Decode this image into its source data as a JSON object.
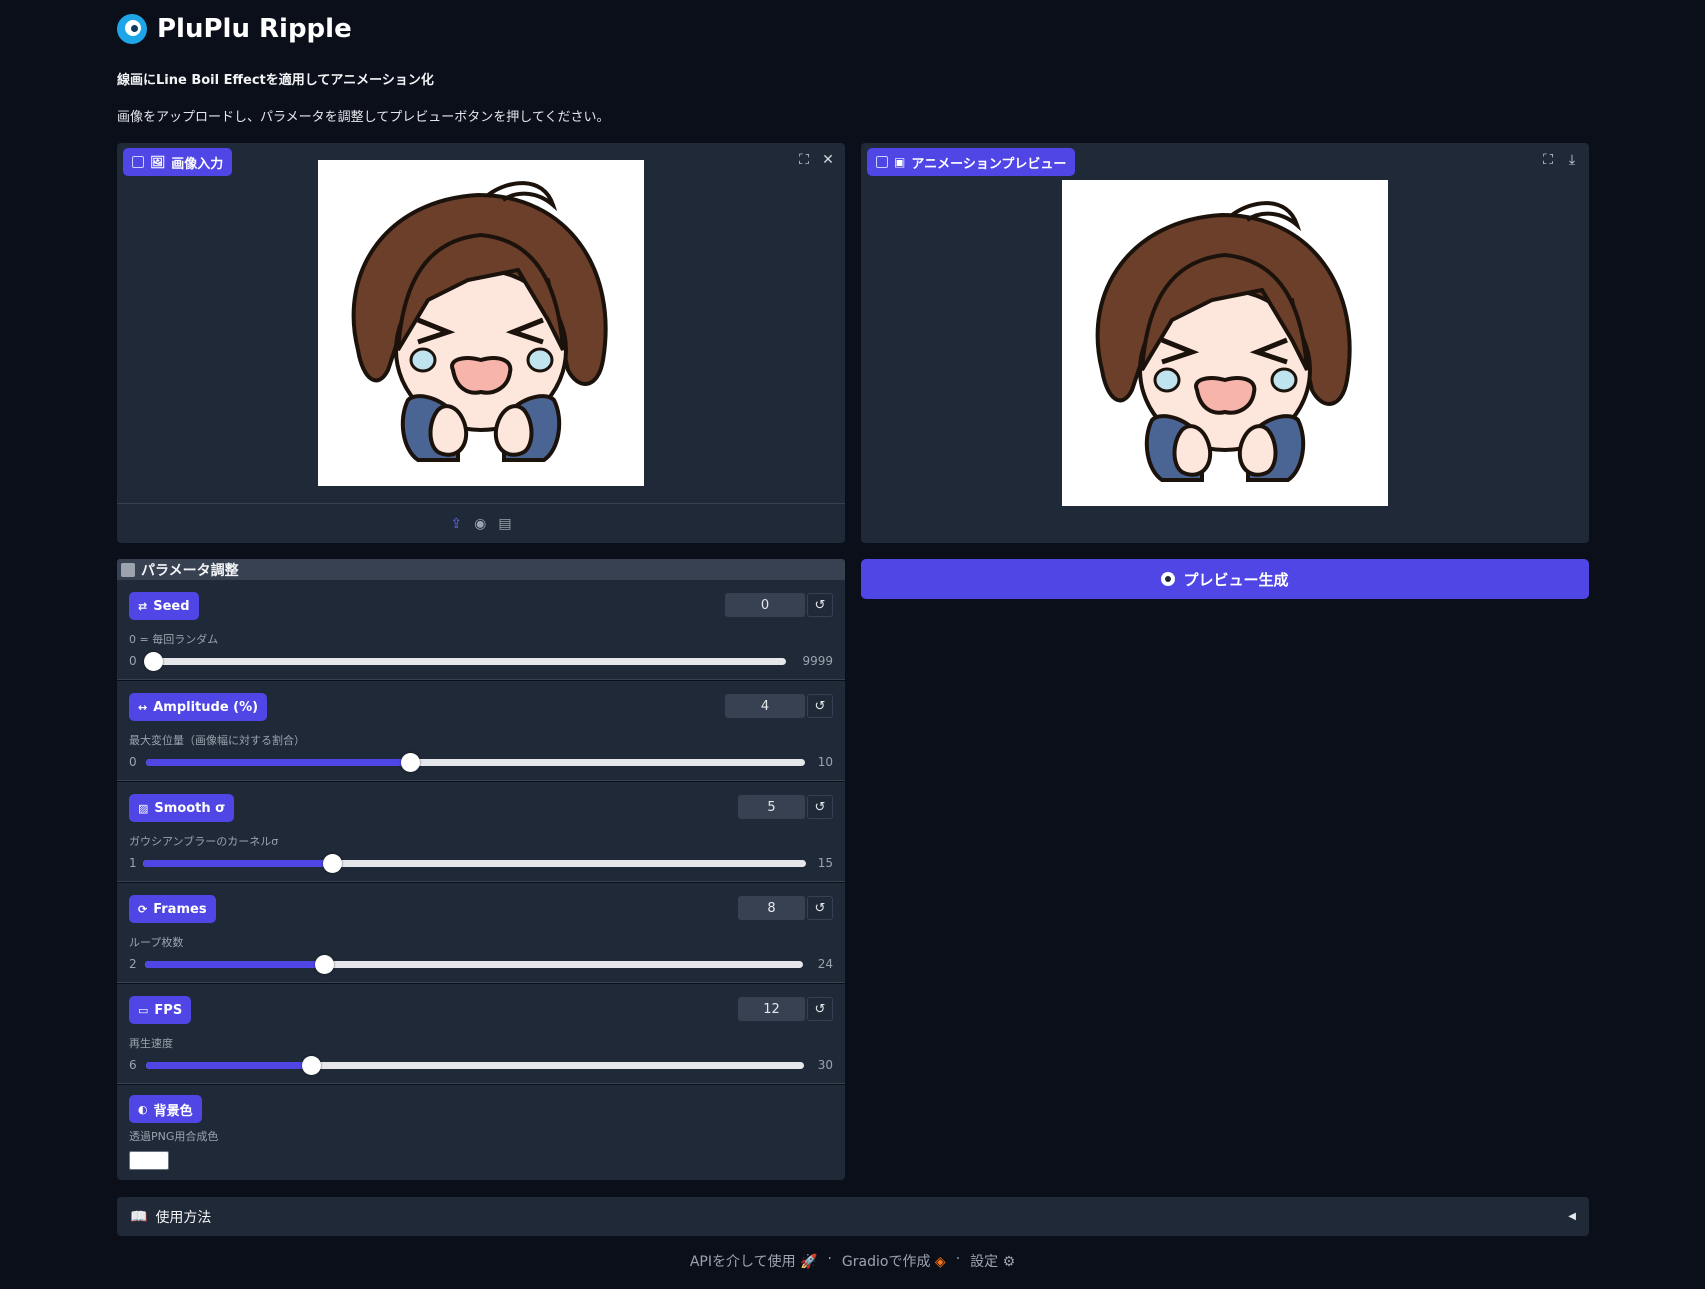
{
  "app": {
    "title": "PluPlu Ripple",
    "subtitle": "線画にLine Boil Effectを適用してアニメーション化",
    "instructions": "画像をアップロードし、パラメータを調整してプレビューボタンを押してください。"
  },
  "image_input": {
    "label": "画像入力",
    "icon": "image-icon"
  },
  "preview": {
    "label": "アニメーションプレビュー",
    "icon": "film-icon"
  },
  "params": {
    "section_title": "パラメータ調整",
    "seed": {
      "label": "Seed",
      "description": "0 = 毎回ランダム",
      "value": "0",
      "min": "0",
      "max": "9999"
    },
    "amplitude": {
      "label": "Amplitude (%)",
      "description": "最大変位量（画像幅に対する割合）",
      "value": "4",
      "min": "0",
      "max": "10"
    },
    "smooth": {
      "label": "Smooth σ",
      "description": "ガウシアンブラーのカーネルσ",
      "value": "5",
      "min": "1",
      "max": "15"
    },
    "frames": {
      "label": "Frames",
      "description": "ループ枚数",
      "value": "8",
      "min": "2",
      "max": "24"
    },
    "fps": {
      "label": "FPS",
      "description": "再生速度",
      "value": "12",
      "min": "6",
      "max": "30"
    },
    "bg_color": {
      "label": "背景色",
      "description": "透過PNG用合成色",
      "value": "#ffffff"
    }
  },
  "buttons": {
    "preview_label": "プレビュー生成"
  },
  "accordion": {
    "label": "使用方法"
  },
  "footer": {
    "api": "APIを介して使用",
    "gradio": "Gradioで作成",
    "settings": "設定",
    "separator": "·"
  },
  "colors": {
    "accent": "#4f46e5",
    "panel": "#1f2937",
    "background": "#0b0f19"
  }
}
